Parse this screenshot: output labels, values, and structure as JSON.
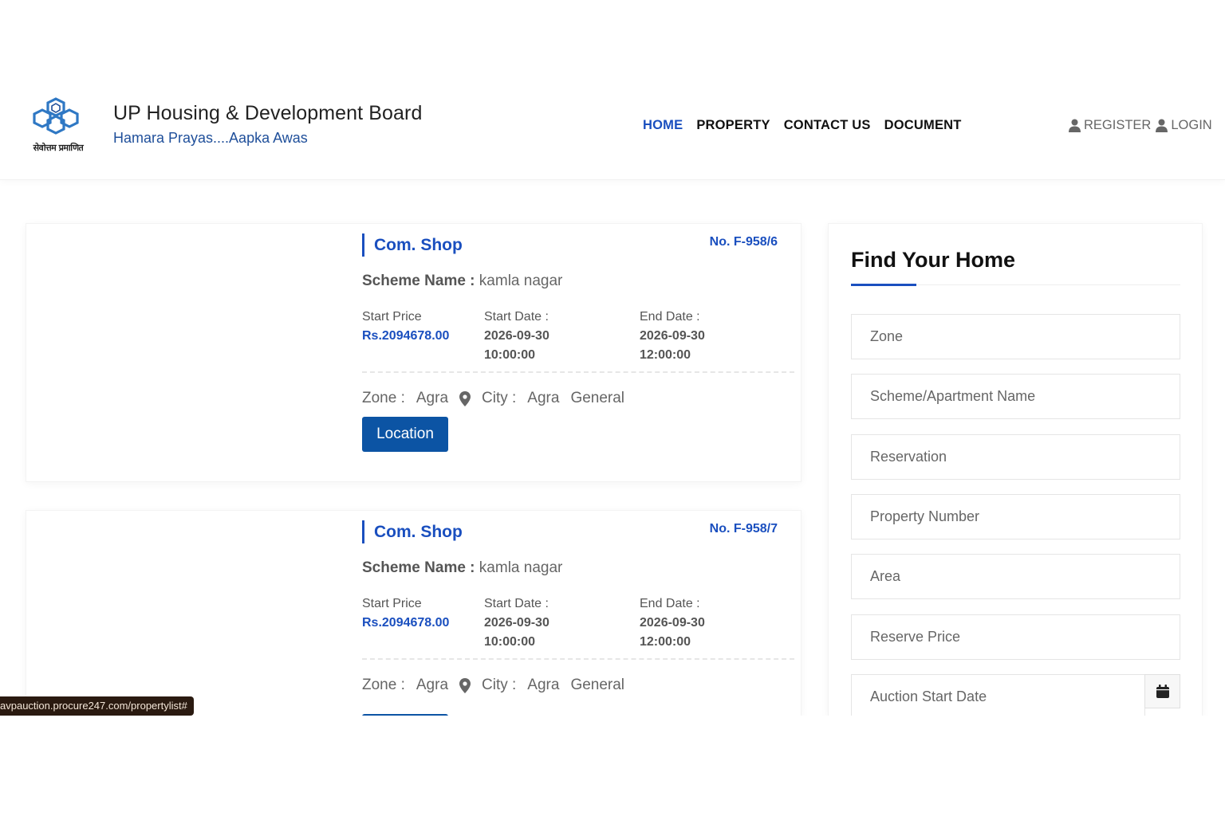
{
  "header": {
    "logo_caption": "सेवोत्तम प्रमाणित",
    "title": "UP Housing & Development Board",
    "tagline": "Hamara Prayas....Aapka Awas",
    "nav": [
      "HOME",
      "PROPERTY",
      "CONTACT US",
      "DOCUMENT"
    ],
    "active_nav": "HOME",
    "register_label": "REGISTER",
    "login_label": "LOGIN"
  },
  "properties": [
    {
      "type": "Com. Shop",
      "number": "No. F-958/6",
      "scheme_label": "Scheme Name :",
      "scheme_value": "kamla nagar",
      "start_price_label": "Start Price",
      "start_price": "Rs.2094678.00",
      "start_date_label": "Start Date :",
      "start_date": "2026-09-30",
      "start_time": "10:00:00",
      "end_date_label": "End Date :",
      "end_date": "2026-09-30",
      "end_time": "12:00:00",
      "zone_label": "Zone :",
      "zone": "Agra",
      "city_label": "City :",
      "city": "Agra",
      "category": "General",
      "button": "Location"
    },
    {
      "type": "Com. Shop",
      "number": "No. F-958/7",
      "scheme_label": "Scheme Name :",
      "scheme_value": "kamla nagar",
      "start_price_label": "Start Price",
      "start_price": "Rs.2094678.00",
      "start_date_label": "Start Date :",
      "start_date": "2026-09-30",
      "start_time": "10:00:00",
      "end_date_label": "End Date :",
      "end_date": "2026-09-30",
      "end_time": "12:00:00",
      "zone_label": "Zone :",
      "zone": "Agra",
      "city_label": "City :",
      "city": "Agra",
      "category": "General"
    }
  ],
  "sidebar": {
    "title": "Find Your Home",
    "fields": [
      "Zone",
      "Scheme/Apartment Name",
      "Reservation",
      "Property Number",
      "Area",
      "Reserve Price",
      "Auction Start Date"
    ]
  },
  "status_url": "avpauction.procure247.com/propertylist#",
  "colors": {
    "primary": "#1a4fbf",
    "button": "#0c54a4"
  }
}
